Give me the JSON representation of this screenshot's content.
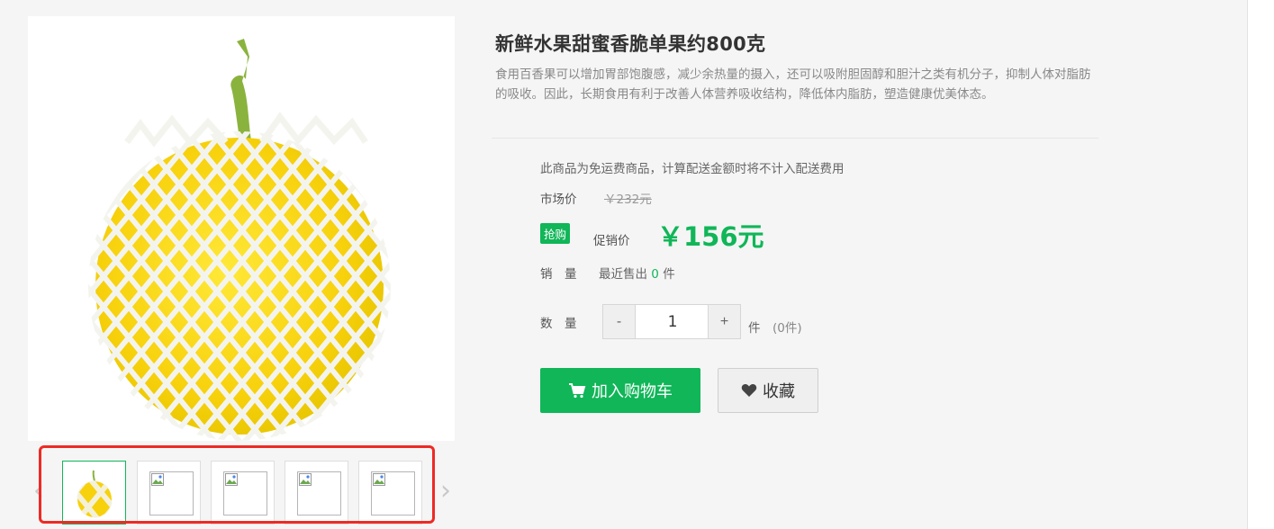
{
  "product": {
    "title": "新鲜水果甜蜜香脆单果约800克",
    "description": "食用百香果可以增加胃部饱腹感，减少余热量的摄入，还可以吸附胆固醇和胆汁之类有机分子，抑制人体对脂肪的吸收。因此，长期食用有利于改善人体营养吸收结构，降低体内脂肪，塑造健康优美体态。"
  },
  "shipping_note": "此商品为免运费商品，计算配送金额时将不计入配送费用",
  "market_price": {
    "label": "市场价",
    "value": "￥232元"
  },
  "promo": {
    "badge": "抢购",
    "label": "促销价",
    "price": "￥156元"
  },
  "sales": {
    "label": "销　量",
    "prefix": "最近售出",
    "count": "0",
    "unit": "件"
  },
  "quantity": {
    "label": "数　量",
    "minus": "-",
    "value": "1",
    "plus": "+",
    "unit": "件",
    "stock": "(0件)"
  },
  "buttons": {
    "add_to_cart": "加入购物车",
    "favorite": "收藏"
  },
  "thumbnails": {
    "count": 5,
    "active_index": 0
  },
  "colors": {
    "accent": "#10b658",
    "highlight": "#ee2a24"
  }
}
